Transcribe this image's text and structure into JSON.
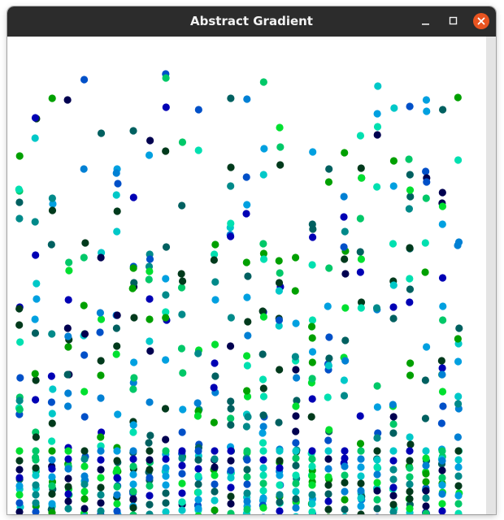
{
  "window": {
    "title": "Abstract Gradient"
  },
  "controls": {
    "minimize_icon": "minimize-icon",
    "maximize_icon": "maximize-icon",
    "close_icon": "close-icon",
    "close_color": "#e95420"
  },
  "palette": [
    "#000050",
    "#003a1c",
    "#0000b4",
    "#0050c8",
    "#0080d4",
    "#00a0e0",
    "#00c8c8",
    "#00e0b0",
    "#00c868",
    "#00e030",
    "#00a000",
    "#008a8a",
    "#006060"
  ]
}
